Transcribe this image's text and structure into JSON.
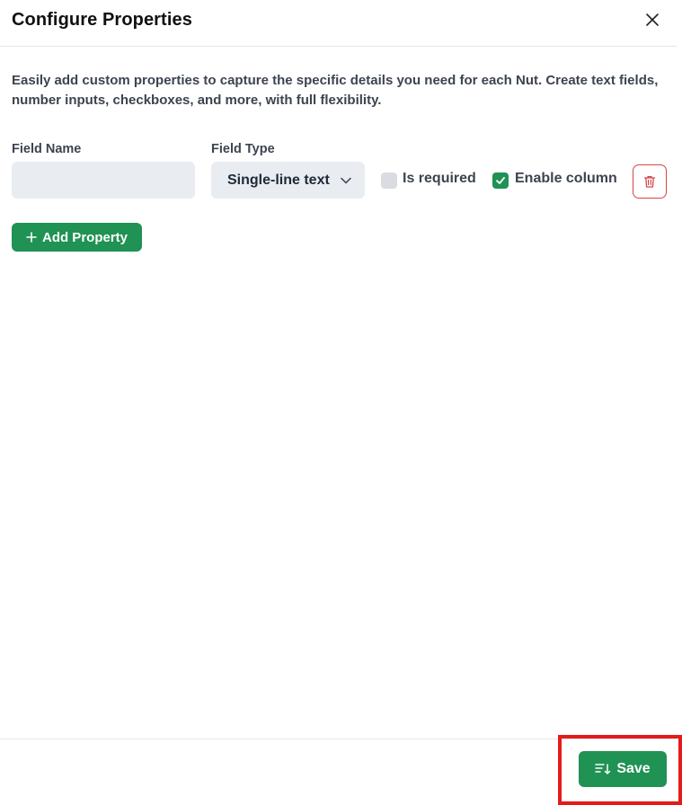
{
  "dialog": {
    "title": "Configure Properties",
    "close_icon": "close-icon",
    "description": "Easily add custom properties to capture the specific details you need for each Nut. Create text fields, number inputs, checkboxes, and more, with full flexibility."
  },
  "property_row": {
    "field_name_label": "Field Name",
    "field_name_value": "",
    "field_type_label": "Field Type",
    "field_type_value": "Single-line text",
    "is_required_label": "Is required",
    "is_required_checked": false,
    "enable_column_label": "Enable column",
    "enable_column_checked": true,
    "delete_icon": "trash-icon"
  },
  "actions": {
    "add_property_label": "Add Property",
    "add_property_icon": "plus-icon",
    "save_label": "Save",
    "save_icon": "sort-down-icon"
  },
  "colors": {
    "accent_green": "#1f9254",
    "danger_red": "#d64545",
    "highlight_red": "#e41b1b",
    "input_bg": "#e9ecf1"
  }
}
